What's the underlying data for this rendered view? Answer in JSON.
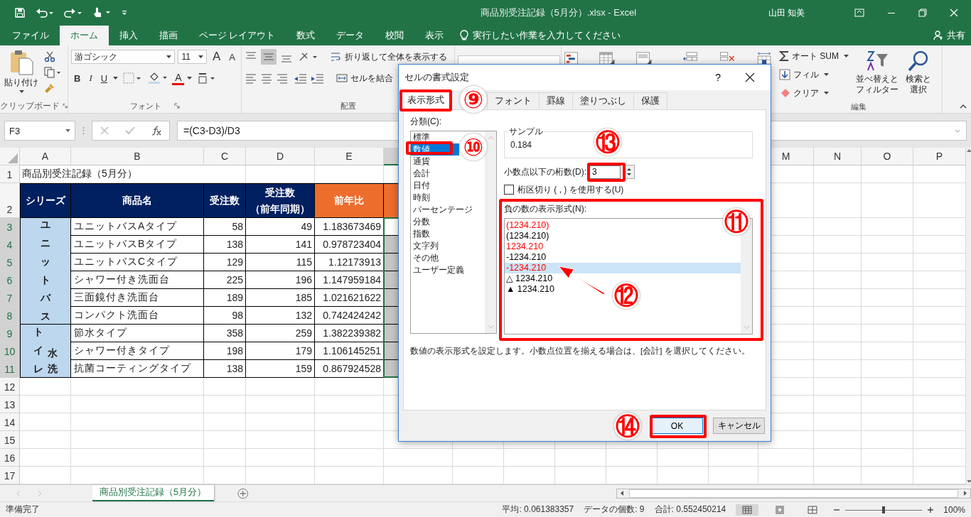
{
  "window": {
    "title": "商品別受注記録（5月分）.xlsx  -  Excel",
    "user": "山田 知美"
  },
  "ribbon_tabs": [
    {
      "label": "ファイル",
      "selected": false
    },
    {
      "label": "ホーム",
      "selected": true
    },
    {
      "label": "挿入",
      "selected": false
    },
    {
      "label": "描画",
      "selected": false
    },
    {
      "label": "ページ レイアウト",
      "selected": false
    },
    {
      "label": "数式",
      "selected": false
    },
    {
      "label": "データ",
      "selected": false
    },
    {
      "label": "校閲",
      "selected": false
    },
    {
      "label": "表示",
      "selected": false
    }
  ],
  "tell_me": {
    "placeholder": "実行したい作業を入力してください"
  },
  "share": "共有",
  "ribbon": {
    "clipboard": {
      "paste": "貼り付け",
      "group": "クリップボード"
    },
    "font": {
      "name": "游ゴシック",
      "size": "11",
      "grow": "A",
      "shrink": "A",
      "bold": "B",
      "italic": "I",
      "underline": "U",
      "foreground": "A",
      "group": "フォント"
    },
    "alignment": {
      "wrap": "折り返して全体を表示する",
      "merge": "セルを結合",
      "group": "配置"
    },
    "editing": {
      "autosum": "オート SUM",
      "fill": "フィル",
      "clear": "クリア",
      "sort": [
        "並べ替えと",
        "フィルター"
      ],
      "find": [
        "検索と",
        "選択"
      ],
      "group": "編集"
    }
  },
  "formula_bar": {
    "name_box": "F3",
    "formula": "=(C3-D3)/D3"
  },
  "sheet": {
    "columns_left": [
      "A",
      "B",
      "C",
      "D",
      "E"
    ],
    "columns_right": [
      "M",
      "N",
      "O",
      "P"
    ],
    "row_numbers": [
      "1",
      "2",
      "3",
      "4",
      "5",
      "6",
      "7",
      "8",
      "9",
      "10",
      "11",
      "12",
      "13",
      "14",
      "15",
      "16",
      "17"
    ],
    "title_cell": "商品別受注記録（5月分）",
    "header": [
      {
        "text": "シリーズ",
        "kind": "navy"
      },
      {
        "text": "商品名",
        "kind": "navy"
      },
      {
        "text": "受注数",
        "kind": "navy"
      },
      {
        "lines": [
          "受注数",
          "（前年同期）"
        ],
        "kind": "navy"
      },
      {
        "text": "前年比",
        "kind": "orange"
      },
      {
        "kind": "orange"
      }
    ],
    "series": [
      {
        "labels": [
          "ユニットバス"
        ],
        "items": [
          {
            "name": "ユニットバスAタイプ",
            "orders": "58",
            "previous": "49",
            "ratio": "1.183673469",
            "selected": true
          },
          {
            "name": "ユニットバスBタイプ",
            "orders": "138",
            "previous": "141",
            "ratio": "0.978723404",
            "selected": true
          },
          {
            "name": "ユニットバスCタイプ",
            "orders": "129",
            "previous": "115",
            "ratio": "1.12173913",
            "selected": true
          },
          {
            "name": "シャワー付き洗面台",
            "orders": "225",
            "previous": "196",
            "ratio": "1.147959184",
            "selected": true
          },
          {
            "name": "三面鏡付き洗面台",
            "orders": "189",
            "previous": "185",
            "ratio": "1.021621622",
            "selected": true
          },
          {
            "name": "コンパクト洗面台",
            "orders": "98",
            "previous": "132",
            "ratio": "0.742424242",
            "selected": true
          }
        ]
      },
      {
        "labels": [
          "トイレ",
          "水洗"
        ],
        "items": [
          {
            "name": "節水タイプ",
            "orders": "358",
            "previous": "259",
            "ratio": "1.382239382",
            "selected": true
          },
          {
            "name": "シャワー付きタイプ",
            "orders": "198",
            "previous": "179",
            "ratio": "1.106145251",
            "selected": true
          },
          {
            "name": "抗菌コーティングタイプ",
            "orders": "138",
            "previous": "159",
            "ratio": "0.867924528",
            "selected": true
          }
        ]
      }
    ],
    "sheet_tabs": [
      {
        "label": "商品別受注記録（5月分）",
        "selected": true
      }
    ]
  },
  "dialog": {
    "title": "セルの書式設定",
    "help": "?",
    "tabs": [
      {
        "label": "表示形式",
        "selected": true
      },
      {
        "label": "フォント",
        "selected": false
      },
      {
        "label": "罫線",
        "selected": false
      },
      {
        "label": "塗りつぶし",
        "selected": false
      },
      {
        "label": "保護",
        "selected": false
      }
    ],
    "category_label": "分類(C):",
    "categories": [
      {
        "label": "標準",
        "selected": false
      },
      {
        "label": "数値",
        "selected": true
      },
      {
        "label": "通貨",
        "selected": false
      },
      {
        "label": "会計",
        "selected": false
      },
      {
        "label": "日付",
        "selected": false
      },
      {
        "label": "時刻",
        "selected": false
      },
      {
        "label": "パーセンテージ",
        "selected": false
      },
      {
        "label": "分数",
        "selected": false
      },
      {
        "label": "指数",
        "selected": false
      },
      {
        "label": "文字列",
        "selected": false
      },
      {
        "label": "その他",
        "selected": false
      },
      {
        "label": "ユーザー定義",
        "selected": false
      }
    ],
    "sample_label": "サンプル",
    "sample": "0.184",
    "decimals_label": "小数点以下の桁数(D):",
    "decimals": "3",
    "separator": {
      "label": "桁区切り ( , ) を使用する(U)",
      "checked": false
    },
    "negative_label": "負の数の表示形式(N):",
    "negative_formats": [
      {
        "text": "(1234.210)",
        "color": "#ff0000",
        "selected": false
      },
      {
        "text": "(1234.210)",
        "color": "#000000",
        "selected": false
      },
      {
        "text": "1234.210",
        "color": "#ff0000",
        "selected": false
      },
      {
        "text": "-1234.210",
        "color": "#000000",
        "selected": false
      },
      {
        "text": "-1234.210",
        "color": "#ff0000",
        "selected": true
      },
      {
        "text": "△ 1234.210",
        "color": "#000000",
        "selected": false
      },
      {
        "text": "▲ 1234.210",
        "color": "#000000",
        "selected": false
      }
    ],
    "description": "数値の表示形式を設定します。小数点位置を揃える場合は、[会計] を選択してください。",
    "ok": "OK",
    "cancel": "キャンセル"
  },
  "annotations": [
    "⑨",
    "⑩",
    "⑬",
    "⑪",
    "⑫",
    "⑭"
  ],
  "status_bar": {
    "ready": "準備完了",
    "average": "平均: 0.061383357",
    "count": "データの個数: 9",
    "sum": "合計: 0.552450214",
    "zoom": "100%",
    "level": 0.5
  }
}
